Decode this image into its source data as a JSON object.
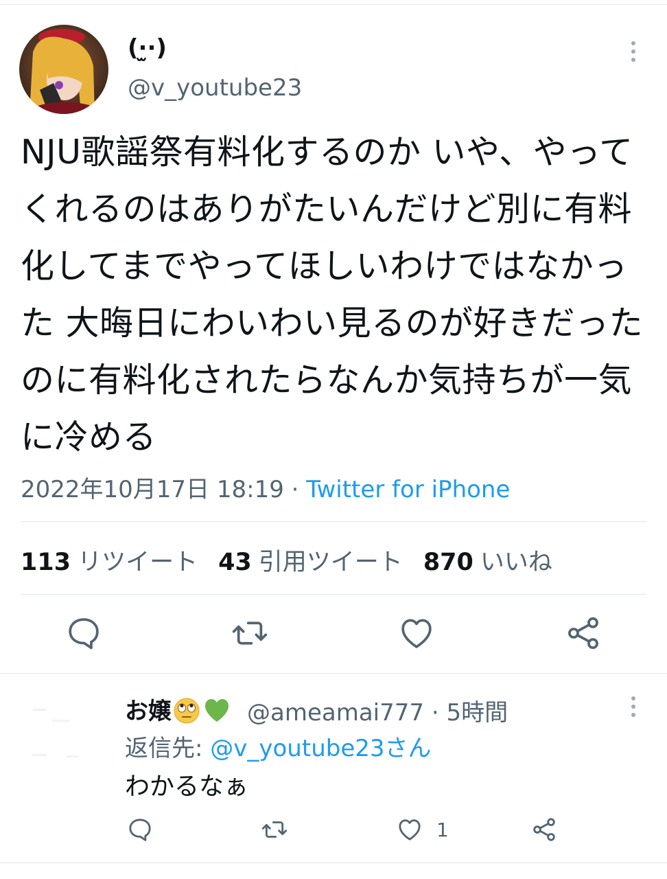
{
  "tweet": {
    "author_name": "(·̫·)",
    "author_handle": "@v_youtube23",
    "text": "NJU歌謡祭有料化するのか いや、やってくれるのはありがたいんだけど別に有料化してまでやってほしいわけではなかった 大晦日にわいわい見るのが好きだったのに有料化されたらなんか気持ちが一気に冷める",
    "timestamp": "2022年10月17日 18:19",
    "separator": " · ",
    "source": "Twitter for iPhone",
    "stats": {
      "retweets_count": "113",
      "retweets_label": "リツイート",
      "quotes_count": "43",
      "quotes_label": "引用ツイート",
      "likes_count": "870",
      "likes_label": "いいね"
    },
    "icons": [
      "reply-icon",
      "retweet-icon",
      "like-icon",
      "share-icon",
      "more-icon"
    ]
  },
  "reply": {
    "author_name": "お嬢",
    "author_emojis": [
      "rolling-eyes-emoji",
      "green-heart-emoji"
    ],
    "author_handle": "@ameamai777",
    "separator": " · ",
    "time": "5時間",
    "reply_to_label": "返信先: ",
    "reply_to_handle": "@v_youtube23さん",
    "text": "わかるなぁ",
    "like_count": "1"
  },
  "colors": {
    "text": "#0f1419",
    "secondary": "#536471",
    "link": "#1d9bf0",
    "divider": "#e1e6ea"
  }
}
